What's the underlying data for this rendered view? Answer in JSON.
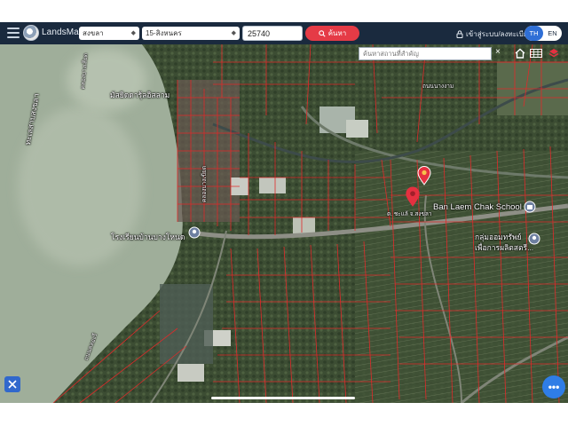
{
  "header": {
    "brand": "LandsMaps",
    "province": "สงขลา",
    "district": "15-สิงหนคร",
    "postcode": "25740",
    "search_label": "ค้นหา",
    "login_label": "เข้าสู่ระบบ/ลงทะเบียน",
    "lang_th": "TH",
    "lang_en": "EN"
  },
  "map": {
    "search_placeholder": "ค้นหาสถานที่สำคัญ",
    "clear_label": "×",
    "more_label": "•••",
    "labels": {
      "mosque": "มัสยิดดารุ้ลอิสลาม",
      "school": "โรงเรียนบ้านบางโหนด",
      "ban_laem_chak": "Ban Laem Chak School",
      "group_line1": "กลุ่มออมทรัพย์",
      "group_line2": "เพื่อการผลิตสตรี...",
      "khlong_top": "คลองบางเสียด",
      "khlong_left": "ทะเลสาบสงขลา",
      "pin_label": "ต. ชะแล้ จ.สงขลา",
      "road_label": "ถนนนางงาม",
      "khlong_right": "คลองบางเขียด",
      "road_bottom": "ถนนคลองรี"
    }
  },
  "colors": {
    "header_bg": "#1a2a3e",
    "search_button": "#e53b46",
    "accent": "#2f6fd6",
    "parcel_line": "#e02a2a",
    "pin": "#e53040",
    "water": "#9fae9a"
  }
}
